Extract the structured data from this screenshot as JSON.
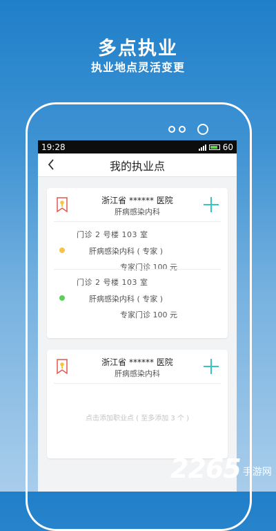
{
  "promo": {
    "title": "多点执业",
    "subtitle": "执业地点灵活变更"
  },
  "status_bar": {
    "time": "19:28",
    "battery": "60"
  },
  "nav": {
    "title": "我的执业点"
  },
  "cards": [
    {
      "hospital": "浙江省 ****** 医院",
      "department": "肝病感染内科",
      "locations": [
        {
          "address": "门诊 2 号楼   103 室",
          "clinic_dept": "肝病感染内科 ( 专家 )",
          "fee": "专家门诊   100 元",
          "status_color": "#f5c542"
        },
        {
          "address": "门诊 2 号楼   103 室",
          "clinic_dept": "肝病感染内科 ( 专家 )",
          "fee": "专家门诊   100 元",
          "status_color": "#5ad05a"
        }
      ]
    },
    {
      "hospital": "浙江省 ****** 医院",
      "department": "肝病感染内科",
      "add_hint": "点击添加职业点 ( 至多添加 3 个 )"
    }
  ],
  "icons": {
    "back": "chevron-left-icon",
    "bookmark": "bookmark-icon",
    "add": "plus-icon"
  },
  "colors": {
    "accent": "#34c6c0",
    "bookmark": "#e4574f"
  },
  "watermark": {
    "number": "2265",
    "text": "手游网"
  }
}
